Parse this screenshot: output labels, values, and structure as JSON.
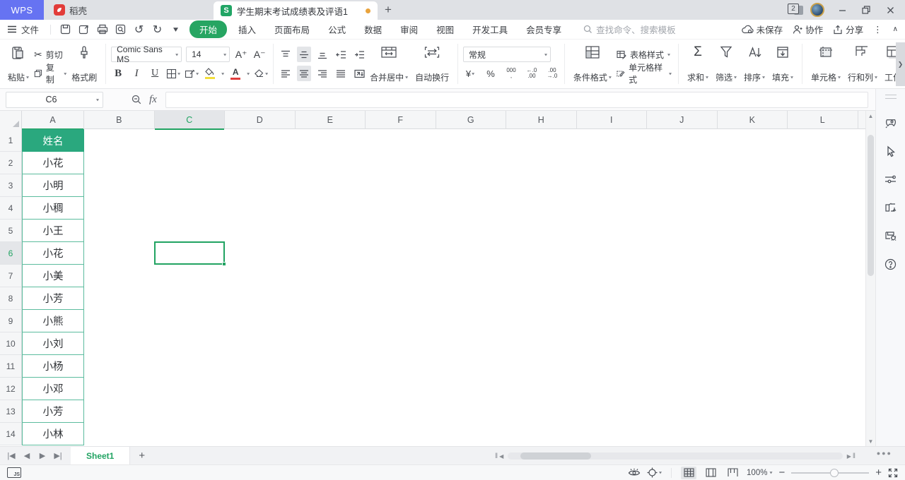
{
  "titlebar": {
    "wps_label": "WPS",
    "store_tab": "稻壳",
    "doc_tab_title": "学生期末考试成绩表及评语1",
    "doc_count_badge": "2"
  },
  "menubar": {
    "file": "文件",
    "active_tab": "开始",
    "tabs": [
      "插入",
      "页面布局",
      "公式",
      "数据",
      "审阅",
      "视图",
      "开发工具",
      "会员专享"
    ],
    "search_placeholder": "查找命令、搜索模板",
    "save_status": "未保存",
    "collaborate": "协作",
    "share": "分享"
  },
  "toolbar": {
    "paste": "粘贴",
    "cut": "剪切",
    "copy": "复制",
    "format_painter": "格式刷",
    "font_name": "Comic Sans MS",
    "font_size": "14",
    "bold": "B",
    "italic": "I",
    "underline": "U",
    "merge_center": "合并居中",
    "wrap_text": "自动换行",
    "number_format": "常规",
    "currency": "¥",
    "percent": "%",
    "thousands": "000",
    "inc_decimal_top": "←.0",
    "inc_decimal_bottom": ".00",
    "dec_decimal_top": ".00",
    "dec_decimal_bottom": "→.0",
    "cond_format": "条件格式",
    "table_style": "表格样式",
    "cell_style": "单元格样式",
    "sum": "求和",
    "filter": "筛选",
    "sort": "排序",
    "fill": "填充",
    "cells": "单元格",
    "rows_cols": "行和列",
    "worksheet": "工作"
  },
  "formula_bar": {
    "name_box": "C6",
    "fx_label": "fx",
    "content": ""
  },
  "grid": {
    "column_headers": [
      "A",
      "B",
      "C",
      "D",
      "E",
      "F",
      "G",
      "H",
      "I",
      "J",
      "K",
      "L"
    ],
    "selected_column": "C",
    "selected_row": 6,
    "selected_cell": "C6",
    "col_a": [
      {
        "row": 1,
        "value": "姓名",
        "is_header": true
      },
      {
        "row": 2,
        "value": "小花"
      },
      {
        "row": 3,
        "value": "小明"
      },
      {
        "row": 4,
        "value": "小稠"
      },
      {
        "row": 5,
        "value": "小王"
      },
      {
        "row": 6,
        "value": "小花"
      },
      {
        "row": 7,
        "value": "小美"
      },
      {
        "row": 8,
        "value": "小芳"
      },
      {
        "row": 9,
        "value": "小熊"
      },
      {
        "row": 10,
        "value": "小刘"
      },
      {
        "row": 11,
        "value": "小杨"
      },
      {
        "row": 12,
        "value": "小邓"
      },
      {
        "row": 13,
        "value": "小芳"
      },
      {
        "row": 14,
        "value": "小林"
      }
    ]
  },
  "sheetbar": {
    "active_sheet": "Sheet1"
  },
  "statusbar": {
    "zoom_level": "100%"
  },
  "colors": {
    "accent_green": "#21a362",
    "table_header_teal": "#2aa87e",
    "table_border_green": "#5cbc9e",
    "wps_blue": "#6673f2",
    "unsaved_dot": "#e9a33c",
    "highlight_yellow": "#f2de3c",
    "font_color_red": "#e03e3e"
  }
}
